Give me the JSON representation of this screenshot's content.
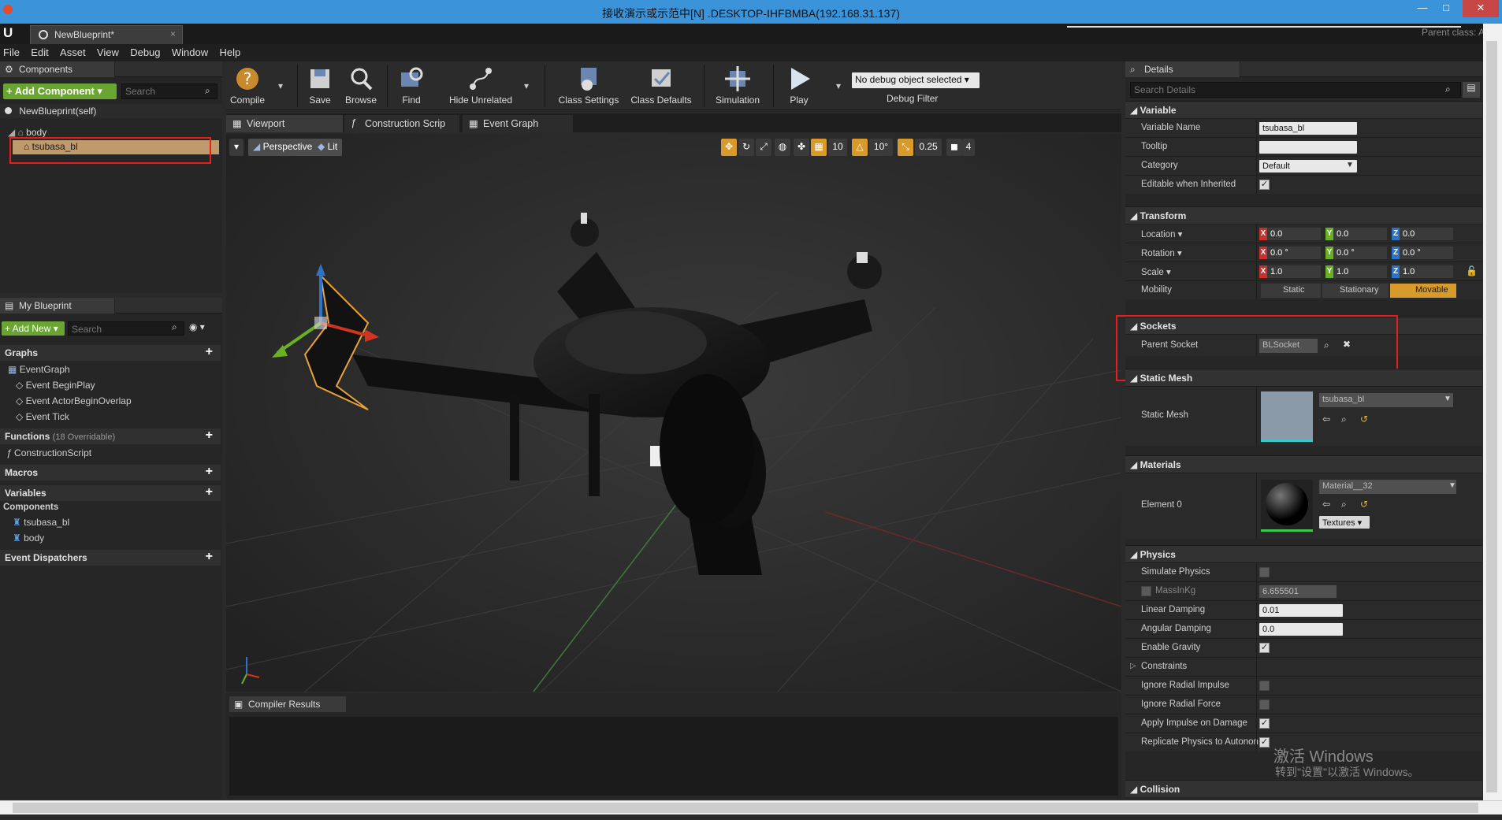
{
  "window": {
    "title": "接收演示或示范中[N] .DESKTOP-IHFBMBA(192.168.31.137)",
    "min": "—",
    "max": "□",
    "close": "✕"
  },
  "doc_tab": {
    "label": "NewBlueprint*",
    "close": "×"
  },
  "parent_class": "Parent class: A",
  "menu": [
    "File",
    "Edit",
    "Asset",
    "View",
    "Debug",
    "Window",
    "Help"
  ],
  "components": {
    "tab": "Components",
    "add_button": "+ Add Component ▾",
    "search_placeholder": "Search",
    "self_label": "NewBlueprint(self)",
    "tree": [
      {
        "label": "body"
      },
      {
        "label": "tsubasa_bl",
        "selected": true
      }
    ]
  },
  "my_blueprint": {
    "tab": "My Blueprint",
    "add_button": "+ Add New ▾",
    "search_placeholder": "Search",
    "graphs": {
      "label": "Graphs"
    },
    "event_graph": "EventGraph",
    "events": [
      "Event BeginPlay",
      "Event ActorBeginOverlap",
      "Event Tick"
    ],
    "functions": {
      "label": "Functions",
      "count": "(18 Overridable)"
    },
    "construction_script": "ConstructionScript",
    "macros": "Macros",
    "variables": "Variables",
    "components_cat": "Components",
    "component_items": [
      "tsubasa_bl",
      "body"
    ],
    "event_dispatchers": "Event Dispatchers"
  },
  "toolbar": {
    "compile": "Compile",
    "save": "Save",
    "browse": "Browse",
    "find": "Find",
    "hide_unrelated": "Hide Unrelated",
    "class_settings": "Class Settings",
    "class_defaults": "Class Defaults",
    "simulation": "Simulation",
    "play": "Play",
    "debug_select": "No debug object selected ▾",
    "debug_filter": "Debug Filter"
  },
  "editor_tabs": [
    "Viewport",
    "Construction Scrip",
    "Event Graph"
  ],
  "viewport": {
    "perspective": "Perspective",
    "lit": "Lit",
    "grid_snap": "10",
    "rot_snap": "10°",
    "scale_snap": "0.25",
    "cam_speed": "4"
  },
  "compiler": {
    "tab": "Compiler Results"
  },
  "details": {
    "tab": "Details",
    "search_placeholder": "Search Details",
    "variable": {
      "label": "Variable",
      "name_label": "Variable Name",
      "name_value": "tsubasa_bl",
      "tooltip_label": "Tooltip",
      "tooltip_value": "",
      "category_label": "Category",
      "category_value": "Default",
      "editable_label": "Editable when Inherited"
    },
    "transform": {
      "label": "Transform",
      "location_label": "Location ▾",
      "rotation_label": "Rotation ▾",
      "scale_label": "Scale ▾",
      "mobility_label": "Mobility",
      "location": [
        "0.0",
        "0.0",
        "0.0"
      ],
      "rotation": [
        "0.0 °",
        "0.0 °",
        "0.0 °"
      ],
      "scale": [
        "1.0",
        "1.0",
        "1.0"
      ],
      "mobility": [
        "Static",
        "Stationary",
        "Movable"
      ]
    },
    "sockets": {
      "label": "Sockets",
      "parent_label": "Parent Socket",
      "parent_value": "BLSocket"
    },
    "static_mesh": {
      "label": "Static Mesh",
      "row_label": "Static Mesh",
      "value": "tsubasa_bl"
    },
    "materials": {
      "label": "Materials",
      "element_label": "Element 0",
      "value": "Material__32",
      "textures": "Textures ▾"
    },
    "physics": {
      "label": "Physics",
      "simulate": "Simulate Physics",
      "mass": "MassInKg",
      "mass_value": "6.655501",
      "linear": "Linear Damping",
      "linear_value": "0.01",
      "angular": "Angular Damping",
      "angular_value": "0.0",
      "gravity": "Enable Gravity",
      "constraints": "Constraints",
      "radial_impulse": "Ignore Radial Impulse",
      "radial_force": "Ignore Radial Force",
      "apply_impulse": "Apply Impulse on Damage",
      "replicate": "Replicate Physics to Autonon"
    },
    "collision": {
      "label": "Collision"
    }
  },
  "watermark": {
    "line1": "激活 Windows",
    "line2": "转到\"设置\"以激活 Windows。"
  },
  "colors": {
    "accent_green": "#6aa533",
    "selection": "#bf9a6b",
    "highlight_red": "#e81e1e",
    "movable": "#d79a2b"
  }
}
